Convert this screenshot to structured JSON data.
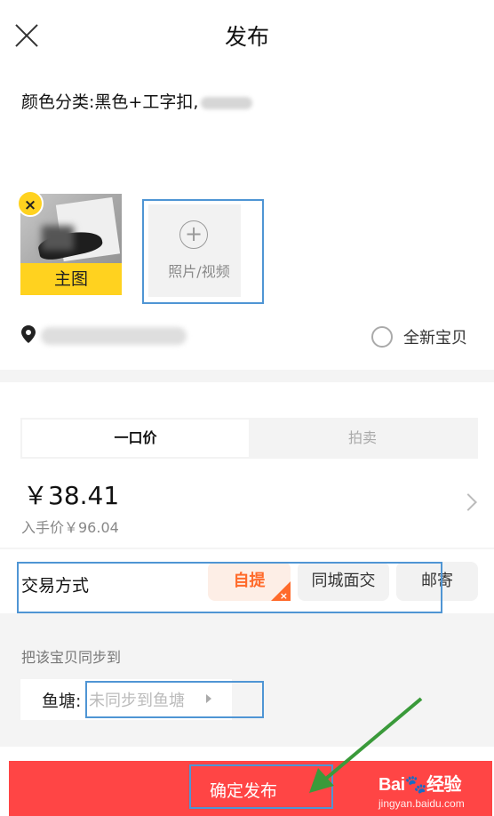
{
  "header": {
    "title": "发布"
  },
  "item": {
    "description": "颜色分类:黑色+工字扣,",
    "main_image_label": "主图",
    "remove_icon": "×",
    "add_media_label": "照片/视频",
    "plus_icon": "+"
  },
  "location": {
    "brand_new_label": "全新宝贝"
  },
  "pricing": {
    "tabs": [
      "一口价",
      "拍卖"
    ],
    "price": "￥38.41",
    "purchase_price": "入手价￥96.04"
  },
  "trade": {
    "label": "交易方式",
    "options": [
      {
        "label": "自提",
        "selected": true
      },
      {
        "label": "同城面交",
        "selected": false
      },
      {
        "label": "邮寄",
        "selected": false
      }
    ],
    "selected_mark": "×"
  },
  "sync": {
    "title": "把该宝贝同步到",
    "pond_label": "鱼塘:",
    "pond_value": "未同步到鱼塘"
  },
  "footer": {
    "publish_label": "确定发布",
    "watermark_main": "Bai🐾经验",
    "watermark_sub": "jingyan.baidu.com"
  },
  "colors": {
    "accent_yellow": "#ffd21f",
    "publish_red": "#ff4545",
    "selected_orange": "#ff6a2a",
    "annotation_blue": "#4f95d4",
    "arrow_green": "#3a9a3a"
  }
}
